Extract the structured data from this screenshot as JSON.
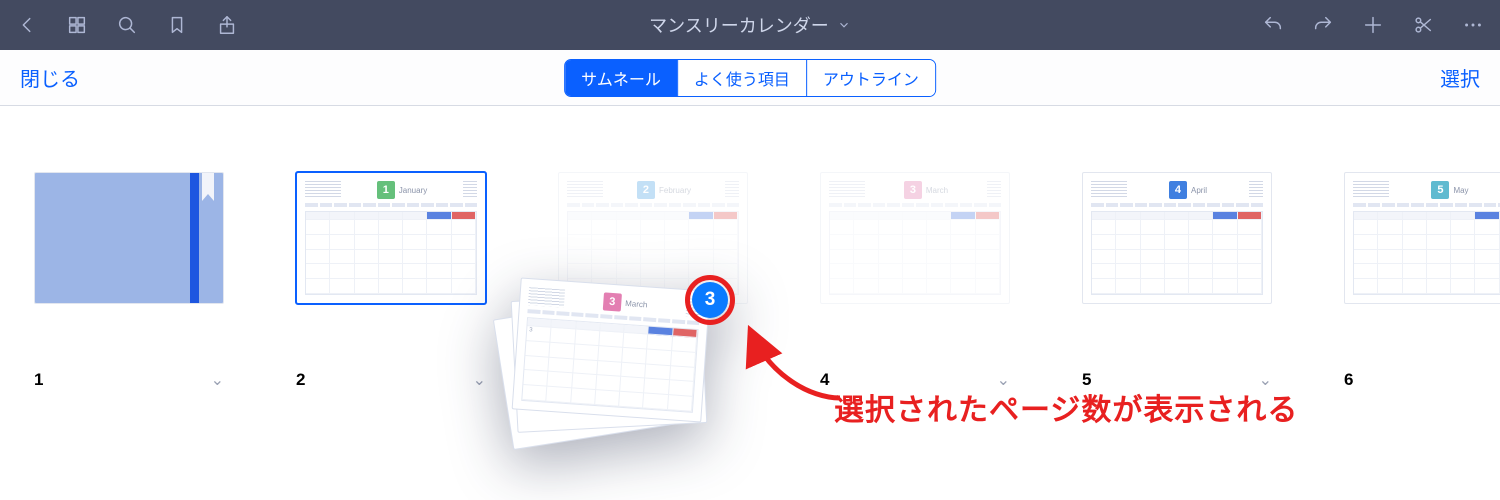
{
  "topbar": {
    "doc_title": "マンスリーカレンダー"
  },
  "subbar": {
    "close": "閉じる",
    "select": "選択",
    "tabs": [
      "サムネール",
      "よく使う項目",
      "アウトライン"
    ],
    "active_tab_index": 0
  },
  "pages": [
    {
      "num": "1",
      "kind": "cover"
    },
    {
      "num": "2",
      "kind": "cal",
      "month_num": "1",
      "month_name": "January",
      "color": "m1",
      "selected": true
    },
    {
      "num": "",
      "kind": "cal",
      "month_num": "2",
      "month_name": "February",
      "color": "m2",
      "faded": true
    },
    {
      "num": "4",
      "kind": "cal",
      "month_num": "3",
      "month_name": "March",
      "color": "m3",
      "faded": true
    },
    {
      "num": "5",
      "kind": "cal",
      "month_num": "4",
      "month_name": "April",
      "color": "m4"
    },
    {
      "num": "6",
      "kind": "cal",
      "month_num": "5",
      "month_name": "May",
      "color": "m5"
    }
  ],
  "drag": {
    "count": "3",
    "month_num": "3",
    "month_name": "March",
    "color": "m3"
  },
  "annotation": "選択されたページ数が表示される"
}
